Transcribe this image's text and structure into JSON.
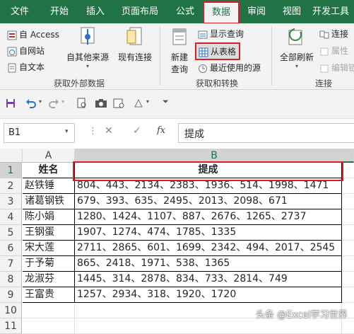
{
  "ribbon_tabs": [
    {
      "label": "文件"
    },
    {
      "label": "开始"
    },
    {
      "label": "插入"
    },
    {
      "label": "页面布局"
    },
    {
      "label": "公式"
    },
    {
      "label": "数据"
    },
    {
      "label": "审阅"
    },
    {
      "label": "视图"
    },
    {
      "label": "开发工具"
    }
  ],
  "ribbon": {
    "get_external": {
      "from_access": "自 Access",
      "from_web": "自网站",
      "from_text": "自文本",
      "other_sources_1": "自其他来源",
      "existing_1": "现有连接",
      "group_label": "获取外部数据"
    },
    "transform": {
      "new_query_1": "新建",
      "new_query_2": "查询",
      "show_queries": "显示查询",
      "from_table": "从表格",
      "recent_sources": "最近使用的源",
      "group_label": "获取和转换"
    },
    "connections": {
      "refresh_all": "全部刷新",
      "connections": "连接",
      "properties": "属性",
      "edit_links": "编辑链",
      "group_label": "连接"
    }
  },
  "formula_bar": {
    "name_box": "B1",
    "fx": "fx",
    "formula": "提成"
  },
  "sheet": {
    "columns": [
      "A",
      "B"
    ],
    "rows": [
      {
        "num": "1",
        "name": "姓名",
        "value": "提成"
      },
      {
        "num": "2",
        "name": "赵铁锤",
        "value": "804、443、2134、2383、1936、514、1998、1471"
      },
      {
        "num": "3",
        "name": "诸葛钢铁",
        "value": "679、393、635、2495、2013、2098、671"
      },
      {
        "num": "4",
        "name": "陈小娟",
        "value": "1280、1424、1107、887、2676、1265、2737"
      },
      {
        "num": "5",
        "name": "王钢蛋",
        "value": "1907、1274、474、1785、1335"
      },
      {
        "num": "6",
        "name": "宋大莲",
        "value": "2711、2865、601、1699、2342、494、2017、2545"
      },
      {
        "num": "7",
        "name": "于予菊",
        "value": "865、2418、1971、538、1365"
      },
      {
        "num": "8",
        "name": "龙淑芬",
        "value": "1445、314、2878、834、733、2814、749"
      },
      {
        "num": "9",
        "name": "王富贵",
        "value": "1257、2934、318、1920、1720"
      },
      {
        "num": "10",
        "name": "",
        "value": ""
      },
      {
        "num": "11",
        "name": "",
        "value": ""
      }
    ]
  },
  "watermark": "头条 @Excel学习世界"
}
